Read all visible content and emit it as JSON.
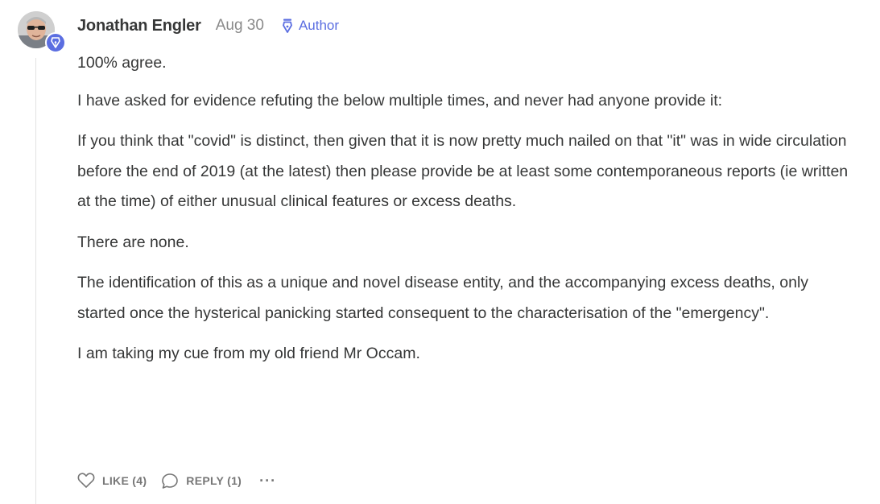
{
  "comment": {
    "author_name": "Jonathan Engler",
    "date": "Aug 30",
    "author_tag": "Author",
    "paragraphs": [
      "100% agree.",
      "I have asked for evidence refuting the below multiple times, and never had anyone provide it:",
      "If you think that \"covid\" is distinct, then given that it is now pretty much nailed on that \"it\" was in wide circulation before the end of 2019 (at the latest) then please provide be at least some contemporaneous reports (ie written at the time) of either unusual clinical features or excess deaths.",
      "There are none.",
      "The identification of this as a unique and novel disease entity, and the accompanying excess deaths, only started once the hysterical panicking started consequent to the characterisation of the \"emergency\".",
      "I am taking my cue from my old friend Mr Occam."
    ],
    "actions": {
      "like_label": "LIKE (4)",
      "reply_label": "REPLY (1)",
      "more_label": "···"
    },
    "icons": {
      "badge": "fountain-pen-icon",
      "like": "heart-icon",
      "reply": "speech-bubble-icon",
      "more": "ellipsis-icon"
    },
    "colors": {
      "accent": "#5b6ee1",
      "text": "#363737",
      "muted": "#8a8a8a"
    }
  }
}
